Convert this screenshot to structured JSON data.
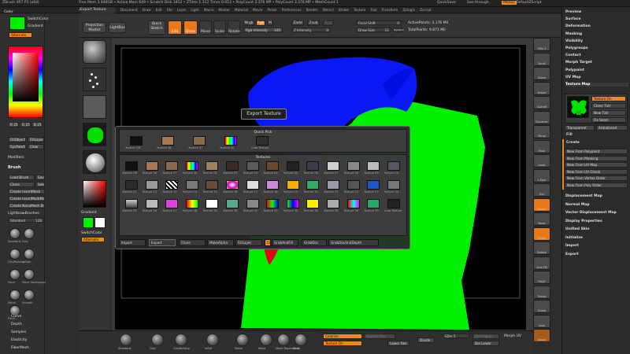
{
  "app": {
    "title_left": "ZBrush 4R7 P3 (x64)",
    "title_center": "Free Mem 3.446GB  •  Active Mem 649  •  Scratch Disk 1812  •  ZTime 1.312  Timer 0.013  •  PolyCount 3.376  MP  •  PolyCount 3.376 MP  •  MeshCount 1",
    "quicksave": "QuickSave",
    "seethrough": "See-through",
    "menus_label": "Menus",
    "script": "DefaultZScript"
  },
  "menubar": [
    "Alpha",
    "Brush",
    "Color",
    "Document",
    "Draw",
    "Edit",
    "File",
    "Layer",
    "Light",
    "Macro",
    "Marker",
    "Material",
    "Movie",
    "Picker",
    "Preferences",
    "Render",
    "Stencil",
    "Stroke",
    "Texture",
    "Tool",
    "Transform",
    "Zplugin",
    "Zscript"
  ],
  "toolbar": {
    "export_texture": "Export Texture",
    "projection_master": "Projection Master",
    "lightbox": "LightBox",
    "quick_sketch": "Quick Sketch",
    "edit": "Edit",
    "draw": "Draw",
    "move": "Move",
    "scale": "Scale",
    "rotate": "Rotate",
    "mrgb": "Mrgb",
    "rgb": "Rgb",
    "m": "M",
    "rgb_intensity": "Rgb Intensity",
    "rgb_intensity_value": "100",
    "zadd": "Zadd",
    "zsub": "Zsub",
    "zcut": "Zcut",
    "z_intensity": "Z Intensity",
    "z_intensity_value": "0",
    "focal_shift": "Focal Shift",
    "focal_shift_value": "0",
    "draw_size": "Draw Size",
    "draw_size_value": "11",
    "dynamic": "Dynamic",
    "active_points": "ActivePoints:",
    "active_points_value": "3.176 Mil",
    "total_points": "TotalPoints:",
    "total_points_value": "9.871 Mil"
  },
  "left": {
    "color_header": "Color",
    "switch_color": "SwitchColor",
    "gradient": "Gradient",
    "alternate": "Alternate",
    "r": "R 255",
    "g": "G 255",
    "b": "B 255",
    "fill_object": "FillObject",
    "fill_layer": "FillLayer",
    "syspalette": "SysPalette",
    "clear": "Clear",
    "modifiers": "Modifiers",
    "brush_header": "Brush",
    "load_brush": "Load Brush",
    "save_as": "Save As",
    "clone": "Clone",
    "select_icon": "SelectIcon",
    "create_insertmesh": "Create InsertMesh",
    "create_insertmultimesh": "Create InsertMultiMesh",
    "create_nanomesh": "Create NanoMesh Brush",
    "lightbox_brushes": "Lightbox▸Brushes",
    "standard": "Standard",
    "standard_value": "128",
    "bottom_items": [
      "Curve",
      "Depth",
      "Samples",
      "Elasticity",
      "FiberMesh"
    ],
    "brushes": [
      "Standard",
      "Clay",
      "ClayBuildup",
      "Inflate",
      "Move",
      "Move Topological",
      "Polish",
      "Smooth",
      "Pinch"
    ]
  },
  "left_tray": {
    "gradient": "Gradient",
    "switch_color": "SwitchColor",
    "alternate": "Alternate"
  },
  "right_panel": {
    "items": [
      "Preview",
      "Surface",
      "Deformation",
      "Masking",
      "Visibility",
      "Polygroups",
      "Contact",
      "Morph Target",
      "Polypaint",
      "UV Map",
      "Texture Map"
    ],
    "texture_on": "Texture On",
    "clone_txtr": "Clone Txtr",
    "new_txtr": "New Txtr",
    "fix_seam": "Fix Seam",
    "transparent": "Transparent",
    "antialiased": "Antialiased",
    "fill": "Fill",
    "create": "Create",
    "new_from": [
      "New From Polypaint",
      "New From Masking",
      "New From UV Map",
      "New From UV Check",
      "New From Vertex Order",
      "New From Poly Order"
    ],
    "items2": [
      "Displacement Map",
      "Normal Map",
      "Vector Displacement Map",
      "Display Properties",
      "Unified Skin",
      "Initialize",
      "Import",
      "Export"
    ]
  },
  "shelf": [
    "SPix 3",
    "Scroll",
    "Zoom",
    "Actual",
    "AAHalf",
    "Dynamic",
    "Persp",
    "Floor",
    "Local",
    "L.Sym",
    "Xyz",
    "Frame",
    "Move",
    "Scale",
    "Rotate",
    "Line Fill",
    "PolyF",
    "Transp",
    "Ghost",
    "Solo",
    "Xpose"
  ],
  "popup": {
    "tooltip": "Export Texture",
    "quick_pick": "Quick Pick",
    "textures": "Textures",
    "quick_items": [
      "Texture Off",
      "Texture 38",
      "Texture 37",
      "Texture 40",
      "Grab Texture"
    ],
    "texture_labels": [
      "Texture Off",
      "Texture 38",
      "Texture 37",
      "Texture 40",
      "Texture 01",
      "Texture 02",
      "Texture 03",
      "Texture 04",
      "Texture 05",
      "Texture 06",
      "Texture 07",
      "Texture 08",
      "Texture 09",
      "Texture 10",
      "Texture 11",
      "Texture 12",
      "Texture 13",
      "Texture 14",
      "Texture 15",
      "Texture 16",
      "Texture 17",
      "Texture 18",
      "Texture 19",
      "Texture 20",
      "Texture 21",
      "Texture 22",
      "Texture 23",
      "Texture 24",
      "Texture 25",
      "Texture 26",
      "Texture 27",
      "Texture 28",
      "Texture 29",
      "Texture 30",
      "Texture 31",
      "Texture 32",
      "Texture 33",
      "Texture 34",
      "Texture 35",
      "Texture 36",
      "Texture 39",
      "Grab Texture"
    ],
    "buttons": [
      "Import",
      "Export",
      "Clone",
      "MakeAlpha",
      "FillLayer",
      "Cd",
      "GrabAndFill",
      "GrabDoc",
      "GrabDocAndDepth"
    ]
  },
  "bottom": {
    "brushes": [
      "Standard",
      "Clay",
      "ClayBuildup",
      "Inflat",
      "Polish",
      "Move",
      "Move Topological",
      "Pinch"
    ],
    "colorize": "Colorize",
    "texture_on": "Texture On",
    "highest_res": "Highest Res",
    "lower_res": "Lower Res",
    "divide": "Divide",
    "sdiv": "SDiv 5",
    "del_higher": "Del Higher",
    "del_lower": "Del Lower",
    "morph_uv": "Morph UV"
  },
  "colors": {
    "accent": "#f08a17",
    "mesh_green": "#00f000",
    "mesh_blue": "#0018ff",
    "lips_red": "#e8001a"
  }
}
